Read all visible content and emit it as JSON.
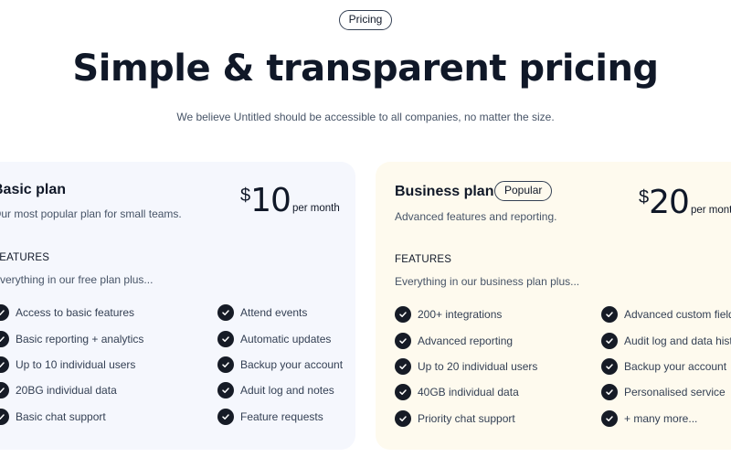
{
  "header": {
    "badge": "Pricing",
    "title": "Simple & transparent pricing",
    "subtitle": "We believe Untitled should be accessible to all companies, no matter the size."
  },
  "plans": [
    {
      "name": "Basic plan",
      "description": "Our most popular plan for small teams.",
      "currency": "$",
      "price": "10",
      "period": "per month",
      "features_label": "FEATURES",
      "features_intro": "Everything in our free plan plus...",
      "features_left": [
        "Access to basic features",
        "Basic reporting + analytics",
        "Up to 10 individual users",
        "20BG individual data",
        "Basic chat support"
      ],
      "features_right": [
        "Attend events",
        "Automatic updates",
        "Backup your account",
        "Aduit log and notes",
        "Feature requests"
      ]
    },
    {
      "name": "Business plan",
      "badge": "Popular",
      "description": "Advanced features and reporting.",
      "currency": "$",
      "price": "20",
      "period": "per month",
      "features_label": "FEATURES",
      "features_intro": "Everything in our business plan plus...",
      "features_left": [
        "200+ integrations",
        "Advanced reporting",
        "Up to 20 individual users",
        "40GB individual data",
        "Priority chat support"
      ],
      "features_right": [
        "Advanced custom fields",
        "Audit log and data history",
        "Backup your account",
        "Personalised service",
        "+ many more..."
      ]
    }
  ]
}
